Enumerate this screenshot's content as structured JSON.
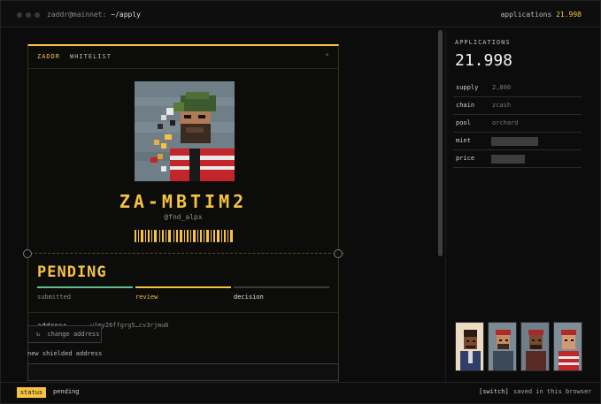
{
  "titlebar": {
    "host": "zaddr@mainnet:",
    "path": "~/apply",
    "applications_label": "applications",
    "applications_count": "21.998"
  },
  "card": {
    "brand": "ZADDR",
    "tag": "WHITELIST",
    "corner_mark": "*",
    "signature_name": "ZA-MBTIM2",
    "handle": "@fnd_alpx",
    "status_title": "PENDING",
    "steps": [
      {
        "label": "submitted",
        "state": "done"
      },
      {
        "label": "review",
        "state": "active"
      },
      {
        "label": "decision",
        "state": "pending"
      }
    ],
    "address_label": "address",
    "address_value": "u1my26ffgrg5…cv3rjmu6",
    "change_button_label": "change address",
    "change_button_icon": "refresh-icon",
    "new_address_label": "new shielded address"
  },
  "sidebar": {
    "title": "APPLICATIONS",
    "count": "21.998",
    "rows": [
      {
        "key": "supply",
        "value": "2,800",
        "redacted": false
      },
      {
        "key": "chain",
        "value": "zcash",
        "redacted": false
      },
      {
        "key": "pool",
        "value": "orchard",
        "redacted": false
      },
      {
        "key": "mint",
        "value": "",
        "redacted": true
      },
      {
        "key": "price",
        "value": "",
        "redacted": true
      }
    ]
  },
  "statusbar": {
    "badge": "status",
    "text": "pending",
    "switch_label": "[switch]",
    "saved_text": "saved in this browser"
  },
  "colors": {
    "accent": "#f5c242",
    "step_done": "#5fbf8f",
    "background": "#0c0c0c"
  }
}
